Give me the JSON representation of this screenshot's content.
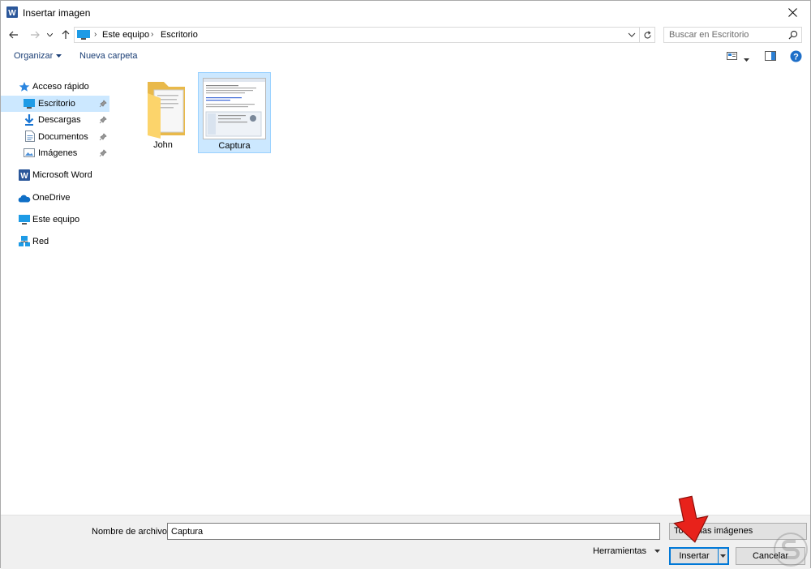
{
  "window": {
    "title": "Insertar imagen",
    "app_icon": "word-icon"
  },
  "address": {
    "crumbs": [
      "Este equipo",
      "Escritorio"
    ],
    "search_placeholder": "Buscar en Escritorio"
  },
  "toolbar": {
    "organize_label": "Organizar",
    "new_folder_label": "Nueva carpeta"
  },
  "sidebar": {
    "items": [
      {
        "label": "Acceso rápido",
        "icon": "star-icon"
      },
      {
        "label": "Escritorio",
        "icon": "desktop-icon",
        "pinned": true,
        "selected": true
      },
      {
        "label": "Descargas",
        "icon": "download-icon",
        "pinned": true
      },
      {
        "label": "Documentos",
        "icon": "document-icon",
        "pinned": true
      },
      {
        "label": "Imágenes",
        "icon": "pictures-icon",
        "pinned": true
      },
      {
        "label": "Microsoft Word",
        "icon": "word-icon"
      },
      {
        "label": "OneDrive",
        "icon": "cloud-icon"
      },
      {
        "label": "Este equipo",
        "icon": "computer-icon"
      },
      {
        "label": "Red",
        "icon": "network-icon"
      }
    ]
  },
  "files": [
    {
      "name": "John",
      "type": "folder",
      "icon": "folder-icon"
    },
    {
      "name": "Captura",
      "type": "image",
      "icon": "image-thumbnail",
      "selected": true
    }
  ],
  "bottom": {
    "filename_label": "Nombre de archivo:",
    "filename_value": "Captura",
    "filter_value": "Todas las imágenes",
    "tools_label": "Herramientas",
    "insert_label": "Insertar",
    "cancel_label": "Cancelar"
  },
  "colors": {
    "accent": "#0078d7",
    "selection": "#cce8ff",
    "arrow": "#e8221b"
  }
}
